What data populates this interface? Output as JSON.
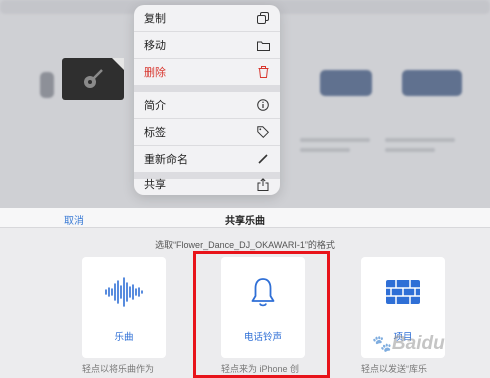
{
  "menu": {
    "items": [
      {
        "label": "复制",
        "icon": "copy-icon"
      },
      {
        "label": "移动",
        "icon": "folder-icon"
      },
      {
        "label": "删除",
        "icon": "trash-icon",
        "color": "#d8362e"
      },
      {
        "label": "简介",
        "icon": "info-icon"
      },
      {
        "label": "标签",
        "icon": "tag-icon"
      },
      {
        "label": "重新命名",
        "icon": "pencil-icon"
      },
      {
        "label": "共享",
        "icon": "share-icon"
      }
    ]
  },
  "sheet": {
    "cancel_label": "取消",
    "title": "共享乐曲",
    "prompt": "选取“Flower_Dance_DJ_OKAWARI-1”的格式",
    "options": [
      {
        "label": "乐曲",
        "icon": "waveform-icon",
        "desc": "轻点以将乐曲作为"
      },
      {
        "label": "电话铃声",
        "icon": "bell-icon",
        "desc": "轻点来为 iPhone 创"
      },
      {
        "label": "项目",
        "icon": "project-icon",
        "desc": "轻点以发送“库乐"
      }
    ]
  },
  "watermark": {
    "text": "Baidu",
    "accent": "#e8131a"
  },
  "colors": {
    "accent": "#2f6fd6",
    "link": "#3a7bd5",
    "destructive": "#d8362e",
    "highlight": "#e8131a"
  }
}
